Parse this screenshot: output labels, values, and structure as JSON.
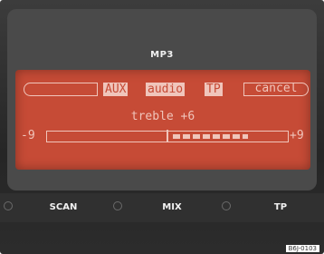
{
  "header": {
    "mode_label": "MP3"
  },
  "display": {
    "menu": {
      "aux": "AUX",
      "audio": "audio",
      "tp": "TP",
      "cancel": "cancel"
    },
    "setting": {
      "label": "treble +6",
      "value": 6,
      "min": -9,
      "max": 9,
      "min_label": "-9",
      "max_label": "+9"
    }
  },
  "buttons": {
    "scan": "SCAN",
    "mix": "MIX",
    "tp": "TP"
  },
  "figure_code": "B6J-0103",
  "colors": {
    "display_bg": "#c64b36",
    "display_text": "#f0c5bb",
    "bezel": "#2c2c2c"
  }
}
